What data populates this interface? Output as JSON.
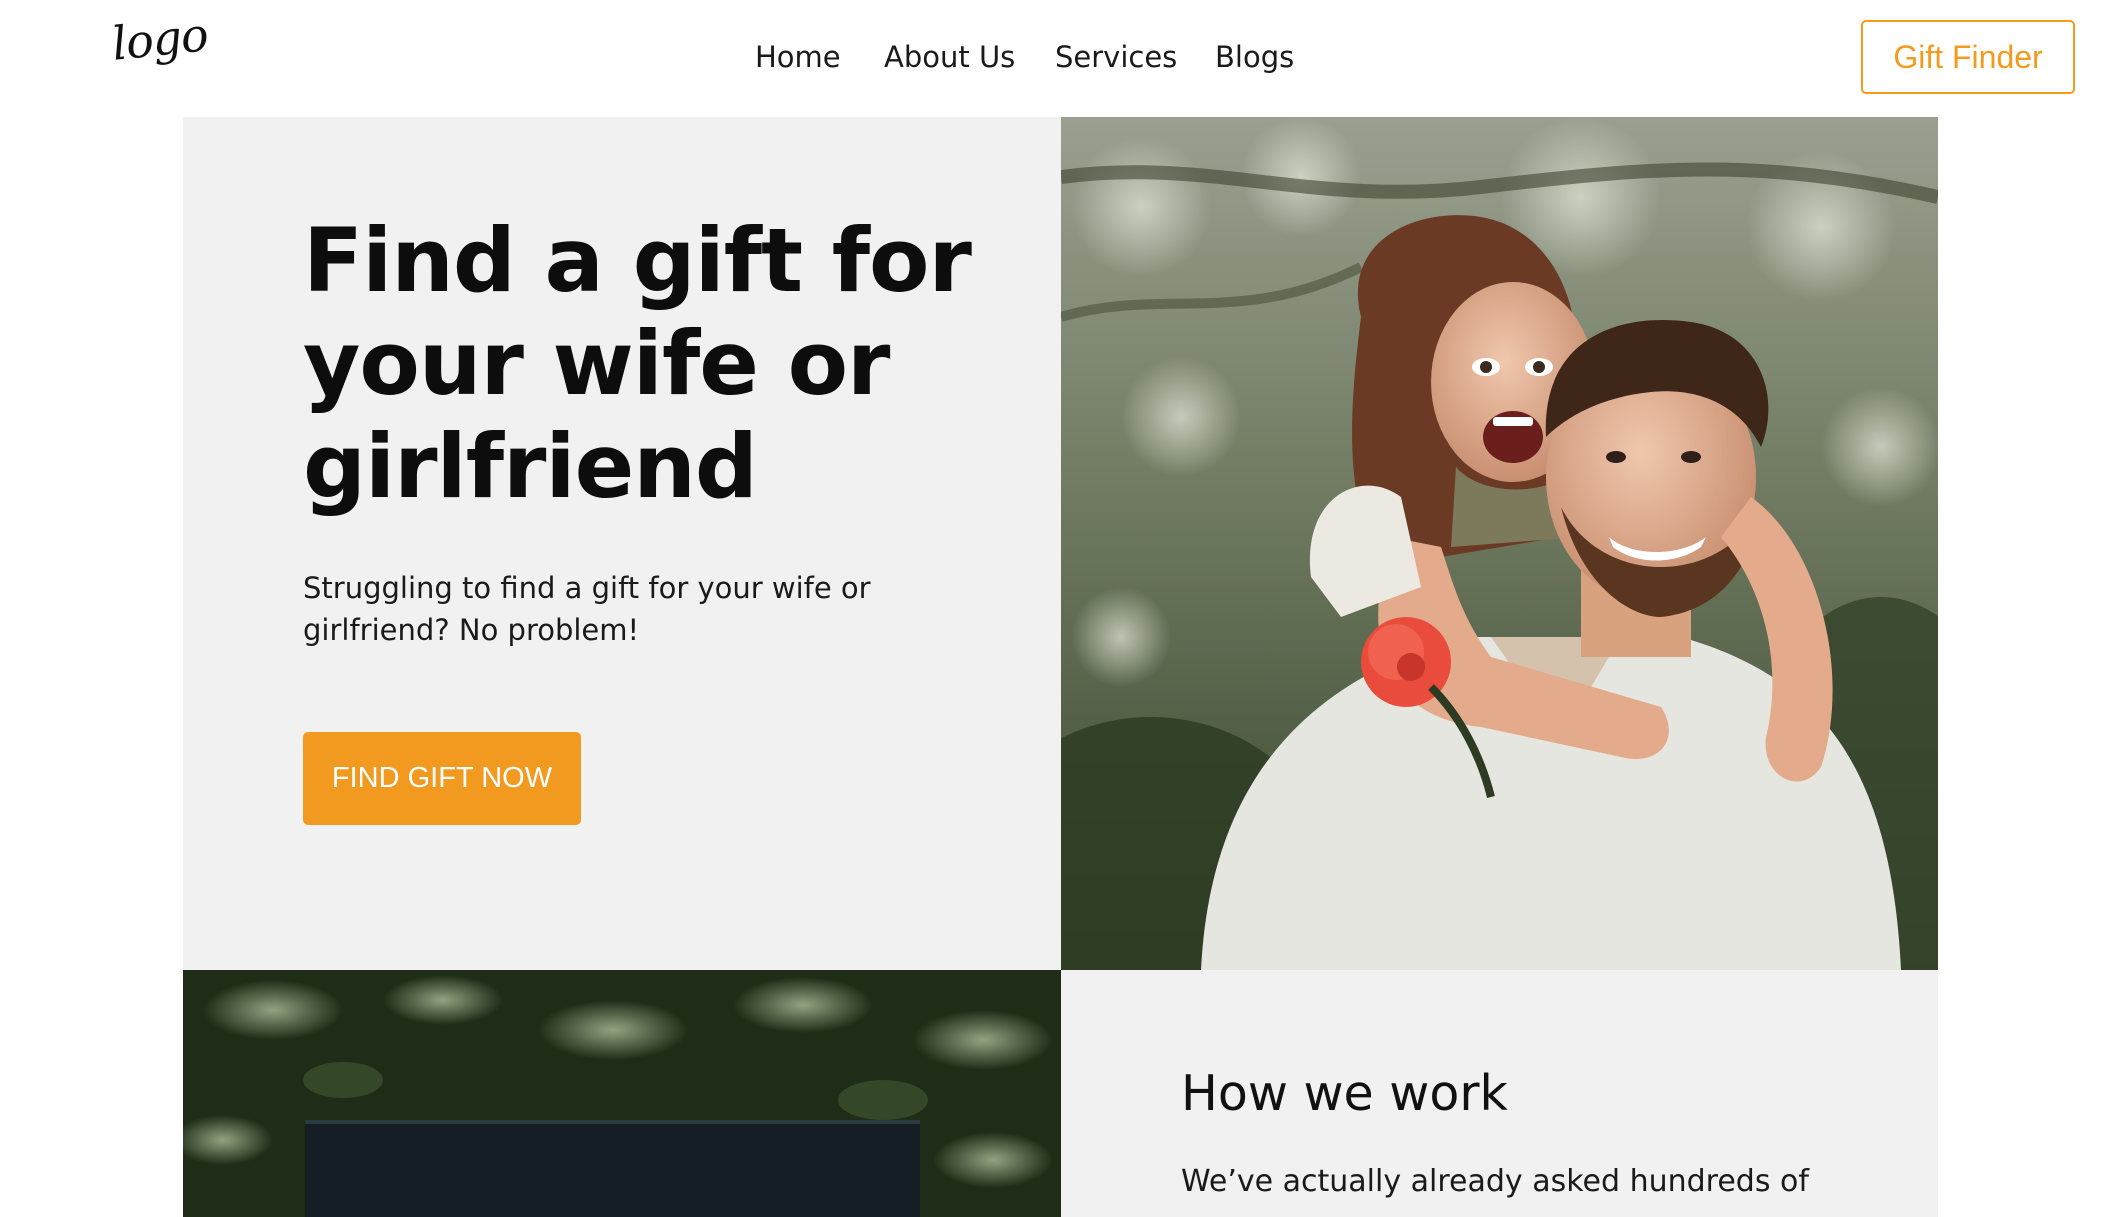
{
  "header": {
    "logo_text": "logo",
    "nav": [
      {
        "label": "Home"
      },
      {
        "label": "About Us"
      },
      {
        "label": "Services"
      },
      {
        "label": "Blogs"
      }
    ],
    "cta_label": "Gift Finder"
  },
  "hero": {
    "title": "Find a gift for your wife or girlfriend",
    "subtitle": "Struggling to find a gift for your wife or girlfriend? No problem!",
    "button_label": "FIND GIFT NOW"
  },
  "how_we_work": {
    "title": "How we work",
    "text": "We’ve actually already asked hundreds of"
  },
  "colors": {
    "accent": "#f29a1f",
    "panel_bg": "#f1f1f1",
    "text": "#111111"
  }
}
